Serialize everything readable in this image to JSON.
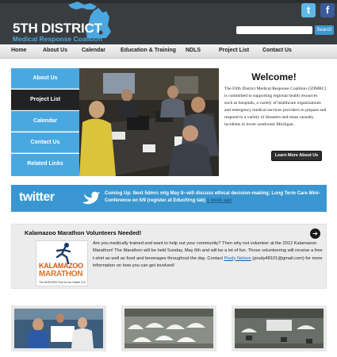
{
  "header": {
    "logo_line1": "5TH DISTRICT",
    "logo_line2": "Medical Response Coalition",
    "twitter_glyph": "t",
    "facebook_glyph": "f",
    "search_placeholder": "",
    "search_button": "Search"
  },
  "nav": {
    "items": [
      "Home",
      "About Us",
      "Calendar",
      "Education & Training",
      "NDLS",
      "Project List",
      "Contact Us"
    ]
  },
  "sidebar": {
    "items": [
      "About Us",
      "Project List",
      "Calendar",
      "Contact Us",
      "Related Links"
    ],
    "active": "Project List"
  },
  "welcome": {
    "title": "Welcome!",
    "body": "The Fifth District Medical Response Coalition (5DMRC) is committed to supporting regional health resources such as hospitals, a variety of healthcare organizations and emergency medical services providers to prepare and respond to a variety of disasters and mass casualty incidents in lower southwest Michigan.",
    "button": "Learn More About Us"
  },
  "twitter": {
    "logo": "twitter",
    "tweet": "Coming Up: Next 5dmrc mtg May 8--will discuss ethical decision-making; Long Term Care Mini-Conference on 5/9 (register at Educ/trng tab)",
    "ago": "1 week ago"
  },
  "news": {
    "title": "Kalamazoo Marathon Volunteers Needed!",
    "arrow": "➔",
    "image_line1": "KALAMAZOO",
    "image_line2": "MARATHON",
    "image_tagline": "The BORGESS Run for the Health of It",
    "body_before_link": "Are you medically trained and want to help out your community? Then why not volunteer at the 2012 Kalamazoo Marathon! The Marathon will be held Sunday, May 6th and will be a lot of fun. Those volunteering will receive a free t-shirt as well as food and beverages throughout the day. Contact ",
    "link_text": "Prudy Nelson",
    "body_after_link": " (prudy48101@gmail.com) for more information on how you can get involved!"
  },
  "colors": {
    "header_bg": "#3a3d40",
    "accent_blue": "#4aa8e0",
    "twitter_blue": "#3a96d0",
    "active_nav": "#222222"
  }
}
